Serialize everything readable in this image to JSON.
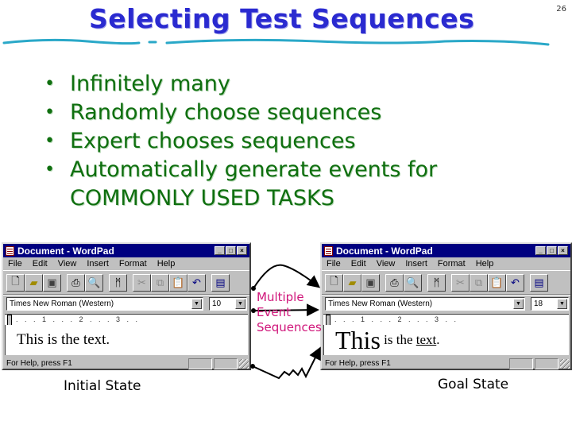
{
  "slide": {
    "title": "Selecting Test Sequences",
    "page_number": "26",
    "colors": {
      "title": "#2a2ad0",
      "bullets": "#0f6f0f",
      "annotation": "#d0157a",
      "underline": "#2aa8c8"
    },
    "bullets": [
      "Infinitely many",
      "Randomly choose sequences",
      "Expert chooses sequences",
      "Automatically generate events for",
      "COMMONLY USED TASKS"
    ],
    "bullet_glyph": "•"
  },
  "initial_window": {
    "title": "Document - WordPad",
    "window_buttons": [
      "_",
      "□",
      "×"
    ],
    "menu": [
      "File",
      "Edit",
      "View",
      "Insert",
      "Format",
      "Help"
    ],
    "toolbar_icons": [
      "new-icon",
      "open-icon",
      "save-icon",
      "print-icon",
      "print-preview-icon",
      "find-icon",
      "cut-icon",
      "copy-icon",
      "paste-icon",
      "undo-icon",
      "insert-object-icon"
    ],
    "font_name": "Times New Roman (Western)",
    "font_size": "10",
    "ruler_marks": ". . . 1 . . . 2 . . . 3 . .",
    "document_text": "This is the text.",
    "status_text": "For Help, press F1"
  },
  "goal_window": {
    "title": "Document - WordPad",
    "window_buttons": [
      "_",
      "□",
      "×"
    ],
    "menu": [
      "File",
      "Edit",
      "View",
      "Insert",
      "Format",
      "Help"
    ],
    "toolbar_icons": [
      "new-icon",
      "open-icon",
      "save-icon",
      "print-icon",
      "print-preview-icon",
      "find-icon",
      "cut-icon",
      "copy-icon",
      "paste-icon",
      "undo-icon",
      "insert-object-icon"
    ],
    "font_name": "Times New Roman (Western)",
    "font_size": "18",
    "ruler_marks": ". . . 1 . . . 2 . . . 3 . .",
    "document_text_big": "This",
    "document_text_mid": " is the ",
    "document_text_underlined": "text",
    "document_text_end": ".",
    "status_text": "For Help, press F1"
  },
  "annotation": {
    "lines": [
      "Multiple",
      "Event",
      "Sequences"
    ]
  },
  "labels": {
    "initial_state": "Initial State",
    "goal_state": "Goal State"
  }
}
